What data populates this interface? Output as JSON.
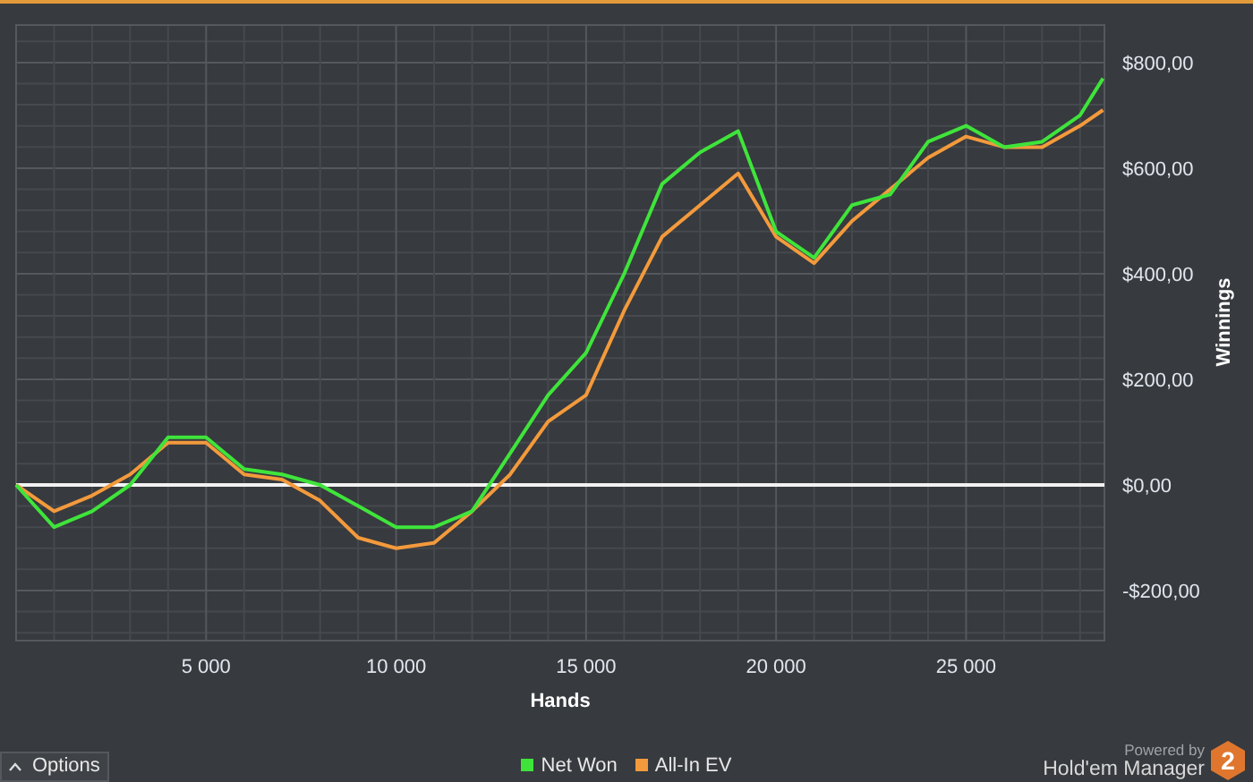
{
  "chart_data": {
    "type": "line",
    "grid": true,
    "xlabel": "Hands",
    "ylabel": "Winnings",
    "xlim": [
      0,
      28640
    ],
    "ylim": [
      -295,
      871
    ],
    "x": [
      0,
      1000,
      2000,
      3000,
      4000,
      5000,
      6000,
      7000,
      8000,
      9000,
      10000,
      11000,
      12000,
      13000,
      14000,
      15000,
      16000,
      17000,
      18000,
      19000,
      20000,
      21000,
      22000,
      23000,
      24000,
      25000,
      26000,
      27000,
      28000,
      28600
    ],
    "series": [
      {
        "name": "Net Won",
        "color": "#3fe43b",
        "values": [
          0,
          -80,
          -50,
          0,
          90,
          90,
          30,
          20,
          0,
          -40,
          -80,
          -80,
          -50,
          60,
          170,
          250,
          400,
          570,
          630,
          670,
          480,
          430,
          530,
          550,
          650,
          680,
          640,
          650,
          700,
          770
        ]
      },
      {
        "name": "All-In EV",
        "color": "#f39a3c",
        "values": [
          0,
          -50,
          -20,
          20,
          80,
          80,
          20,
          10,
          -30,
          -100,
          -120,
          -110,
          -50,
          20,
          120,
          170,
          330,
          470,
          530,
          590,
          470,
          420,
          500,
          560,
          620,
          660,
          640,
          640,
          680,
          710
        ]
      }
    ],
    "xticks": [
      {
        "value": 5000,
        "label": "5 000"
      },
      {
        "value": 10000,
        "label": "10 000"
      },
      {
        "value": 15000,
        "label": "15 000"
      },
      {
        "value": 20000,
        "label": "20 000"
      },
      {
        "value": 25000,
        "label": "25 000"
      }
    ],
    "yticks": [
      {
        "value": 800,
        "label": "$800,00"
      },
      {
        "value": 600,
        "label": "$600,00"
      },
      {
        "value": 400,
        "label": "$400,00"
      },
      {
        "value": 200,
        "label": "$200,00"
      },
      {
        "value": 0,
        "label": "$0,00"
      },
      {
        "value": -200,
        "label": "-$200,00"
      }
    ]
  },
  "options_button": "Options",
  "branding": {
    "powered_by": "Powered by",
    "product": "Hold'em Manager",
    "logo_digit": "2"
  }
}
